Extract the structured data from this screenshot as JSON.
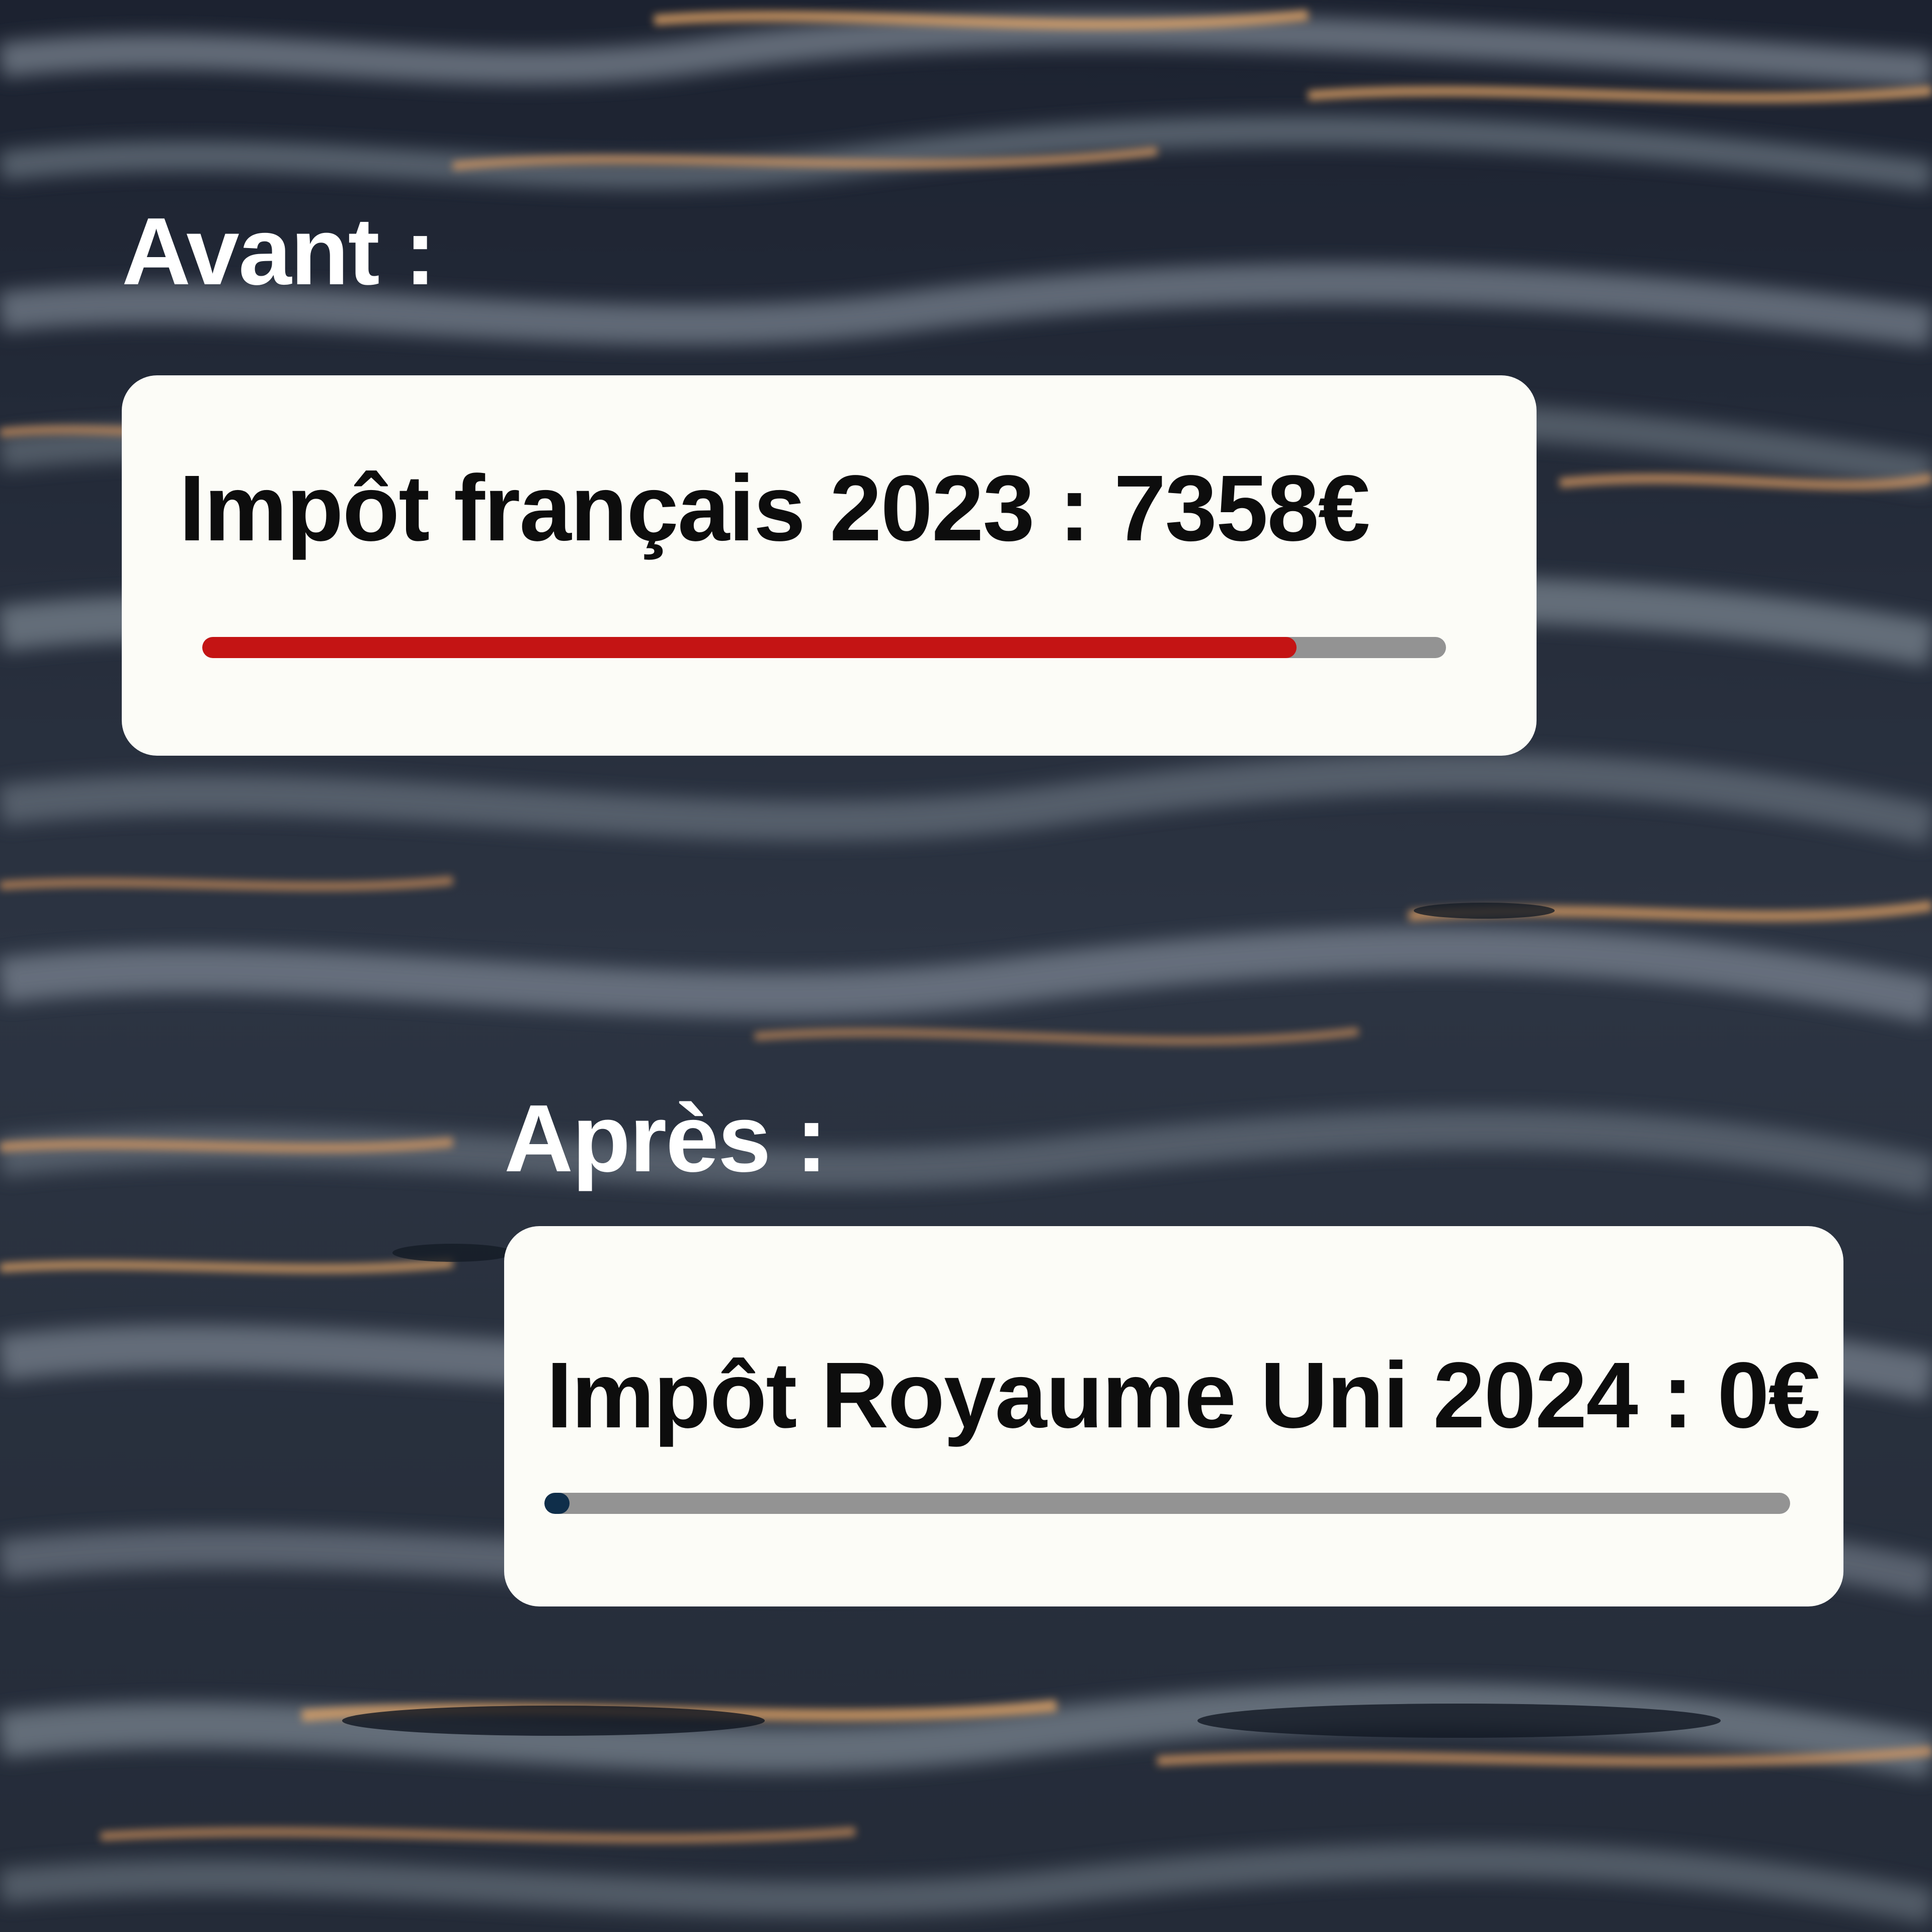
{
  "before": {
    "heading": "Avant :",
    "label": "Impôt français 2023 : 7358€",
    "progress": 0.88,
    "fill_color": "#c41414"
  },
  "after": {
    "heading": "Après :",
    "label": "Impôt Royaume Uni 2024 : 0€",
    "progress": 0.02,
    "fill_color": "#0f2e4a"
  },
  "background": {
    "description_color": "#2a313d",
    "highlight_color": "#e8a868"
  }
}
